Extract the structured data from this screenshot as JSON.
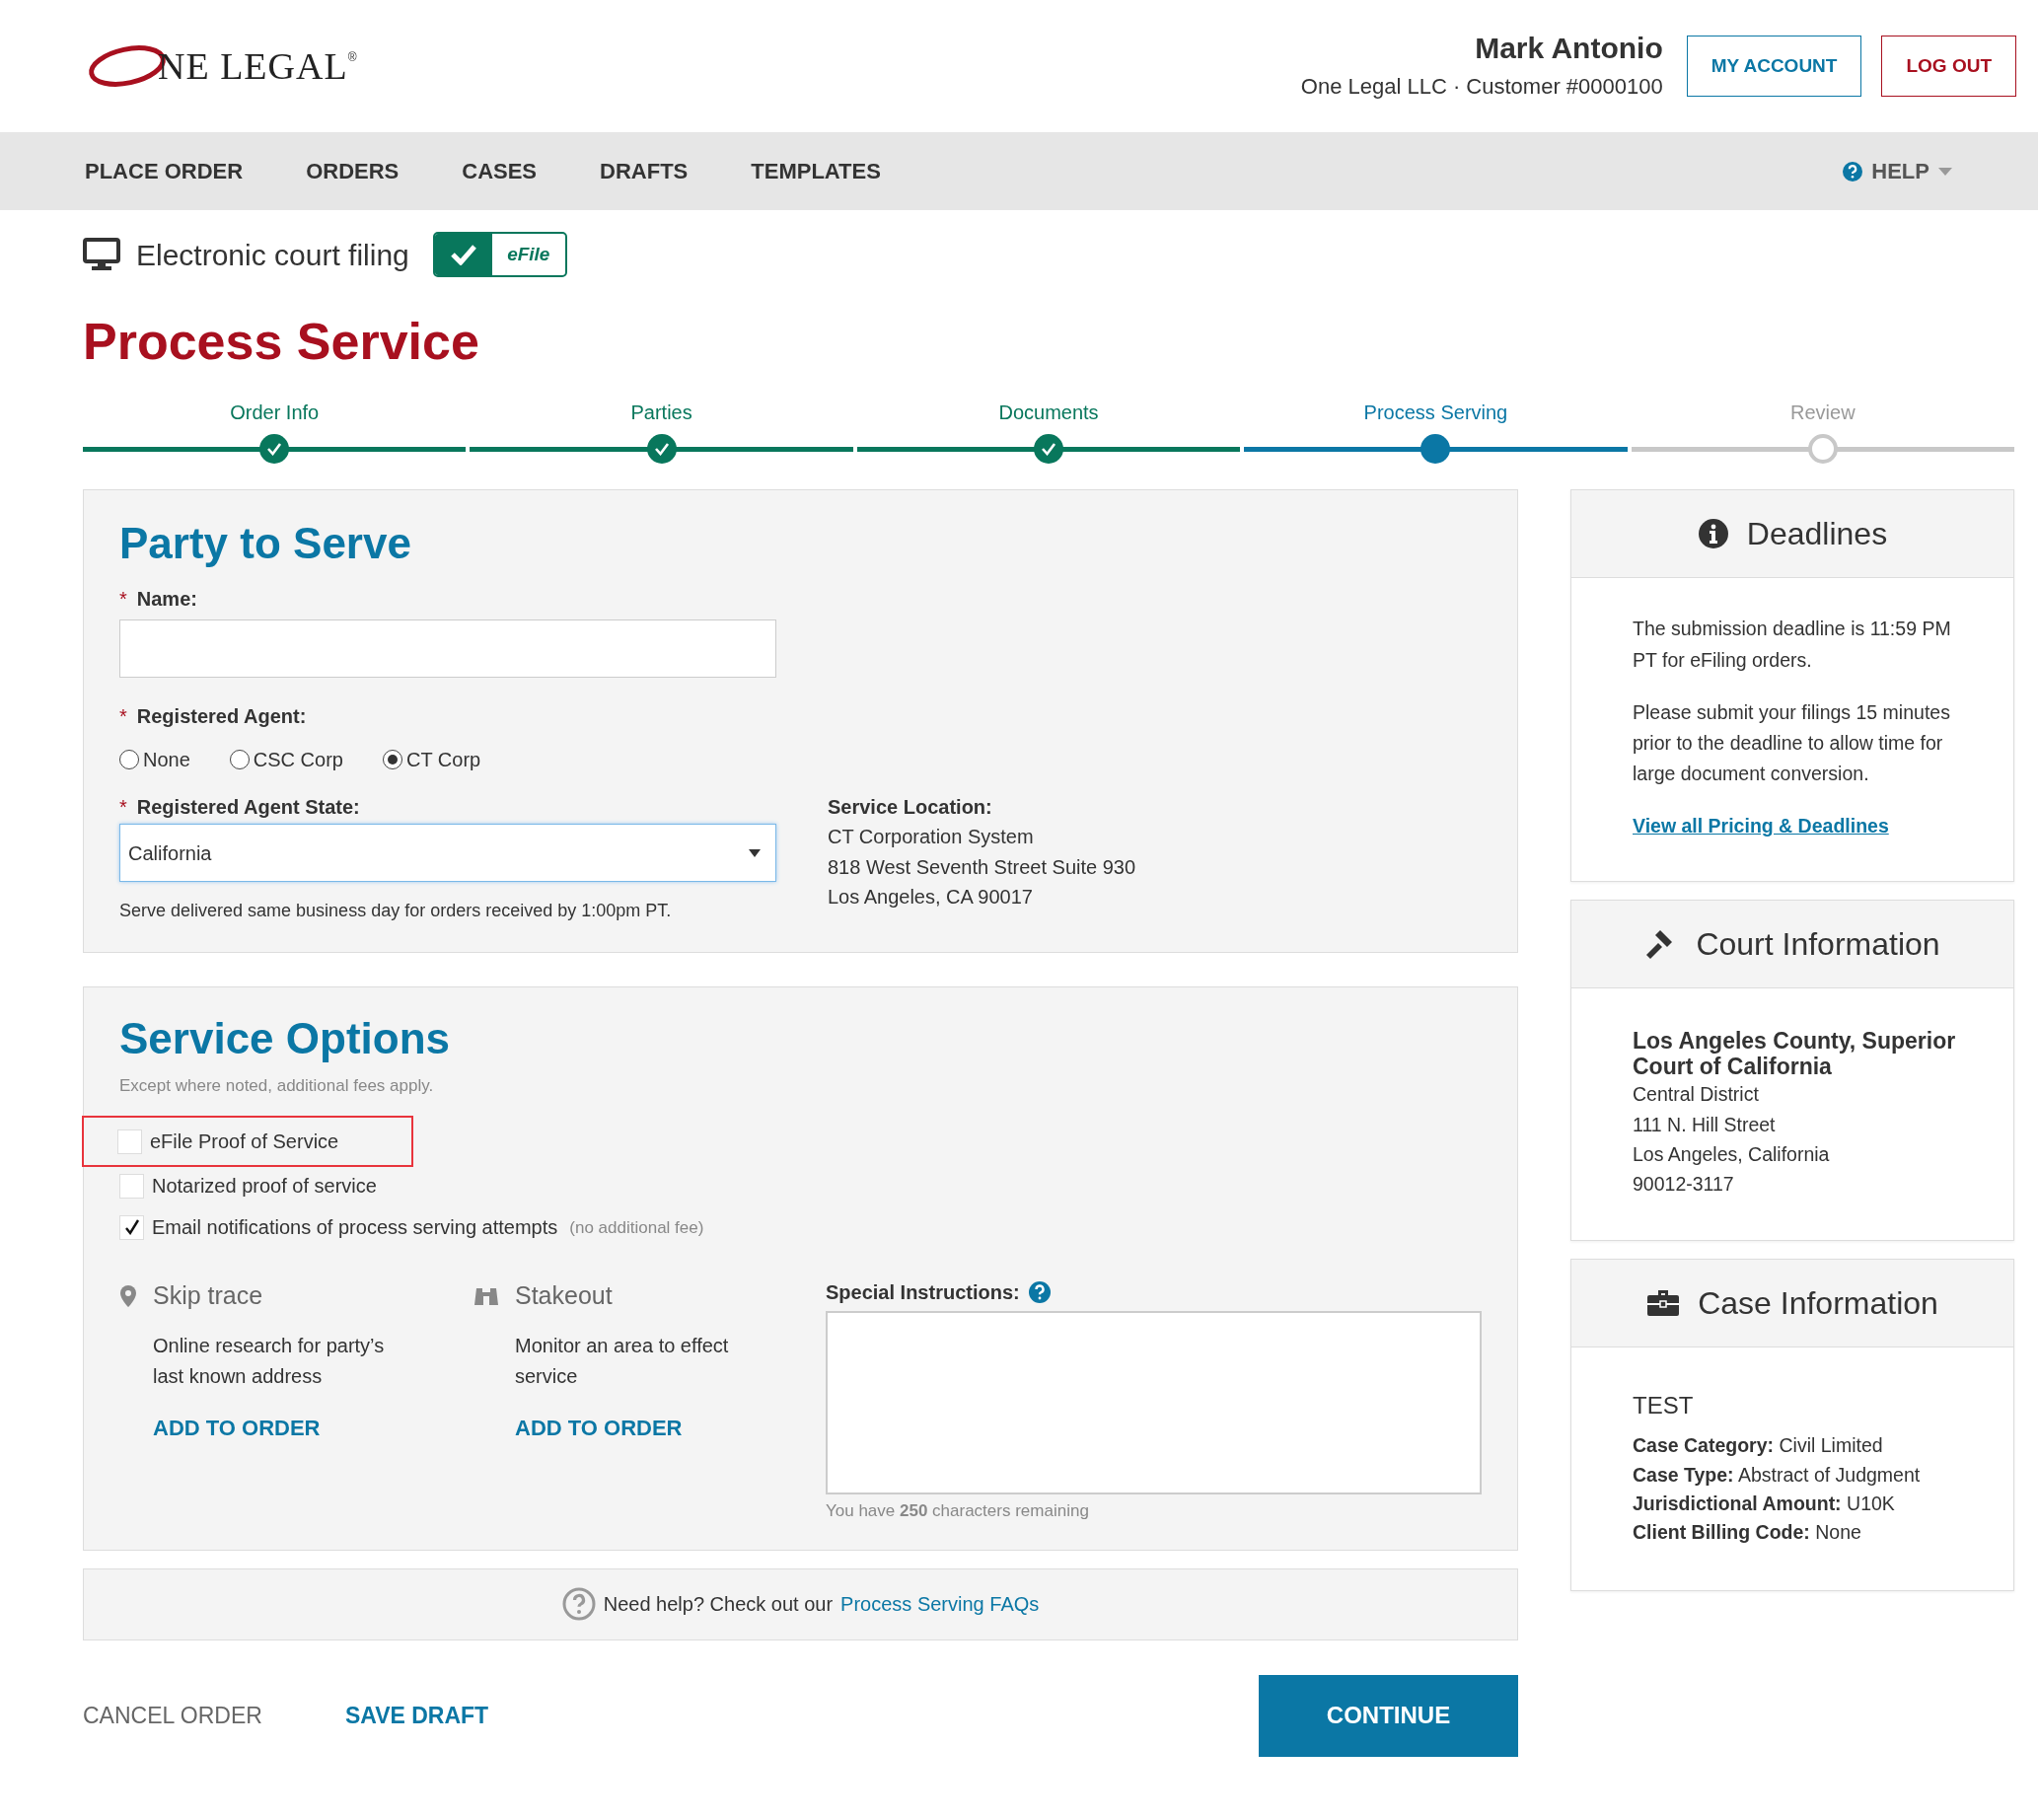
{
  "logo": {
    "text": "NE LEGAL",
    "mark": "®"
  },
  "account": {
    "user_name": "Mark Antonio",
    "details": "One Legal LLC · Customer #0000100",
    "buttons": [
      {
        "label": "MY ACCOUNT",
        "kind": "outline-blue"
      },
      {
        "label": "LOG OUT",
        "kind": "outline-red"
      }
    ]
  },
  "nav": {
    "items": [
      "PLACE ORDER",
      "ORDERS",
      "CASES",
      "DRAFTS",
      "TEMPLATES"
    ],
    "help": "HELP"
  },
  "efile": {
    "label": "Electronic court filing",
    "toggle_label": "eFile",
    "on": true
  },
  "page_title": "Process Service",
  "steps": [
    {
      "label": "Order Info",
      "done": true,
      "selected": false
    },
    {
      "label": "Parties",
      "done": true,
      "selected": false
    },
    {
      "label": "Documents",
      "done": true,
      "selected": false
    },
    {
      "label": "Process Serving",
      "done": false,
      "selected": true
    },
    {
      "label": "Review",
      "done": false,
      "selected": false
    }
  ],
  "party": {
    "title": "Party to Serve",
    "name_label": "Name:",
    "required_mark": "*",
    "agent_label": "Registered Agent:",
    "agent_options": [
      {
        "label": "None",
        "selected": false
      },
      {
        "label": "CSC Corp",
        "selected": false
      },
      {
        "label": "CT Corp",
        "selected": true
      }
    ],
    "state_label": "Registered Agent State:",
    "state_value": "California",
    "note": "Serve delivered same business day for orders received by 1:00pm PT.",
    "location_label": "Service Location:",
    "location_lines": [
      "CT Corporation System",
      "818 West Seventh Street Suite 930",
      "Los Angeles, CA 90017"
    ]
  },
  "service_options": {
    "title": "Service Options",
    "subtitle": "Except where noted, additional fees apply.",
    "options": [
      {
        "label": "eFile Proof of Service",
        "checked": false,
        "highlighted": true
      },
      {
        "label": "Notarized proof of service",
        "checked": false,
        "highlighted": false
      },
      {
        "label": "Email notifications of process serving attempts",
        "note": "(no additional fee)",
        "checked": true,
        "highlighted": false
      }
    ],
    "addons": [
      {
        "title": "Skip trace",
        "description": "Online research for party’s last known address",
        "action": "ADD TO ORDER"
      },
      {
        "title": "Stakeout",
        "description": "Monitor an area to effect service",
        "action": "ADD TO ORDER"
      }
    ],
    "instructions_label": "Special Instructions:",
    "counter": "You have **250** characters remaining"
  },
  "help_bar": {
    "text": "Need help? Check out our",
    "link": "Process Serving FAQs"
  },
  "footer": {
    "cancel": "CANCEL ORDER",
    "save": "SAVE DRAFT",
    "continue": "CONTINUE"
  },
  "sidebar": {
    "deadlines": {
      "title": "Deadlines",
      "paragraphs": [
        "The submission deadline is 11:59 PM PT for eFiling orders.",
        "Please submit your filings 15 minutes prior to the deadline to allow time for large document conversion."
      ],
      "link": "View all Pricing & Deadlines"
    },
    "court": {
      "title": "Court Information",
      "name": "Los Angeles County, Superior Court of California",
      "lines": [
        "Central District",
        "111 N. Hill Street",
        "Los Angeles, California",
        "90012-3117"
      ]
    },
    "case": {
      "title": "Case Information",
      "case_name": "TEST",
      "fields": [
        {
          "label": "Case Category:",
          "value": "Civil Limited"
        },
        {
          "label": "Case Type:",
          "value": "Abstract of Judgment"
        },
        {
          "label": "Jurisdictional Amount:",
          "value": "U10K"
        },
        {
          "label": "Client Billing Code:",
          "value": "None"
        }
      ]
    }
  }
}
